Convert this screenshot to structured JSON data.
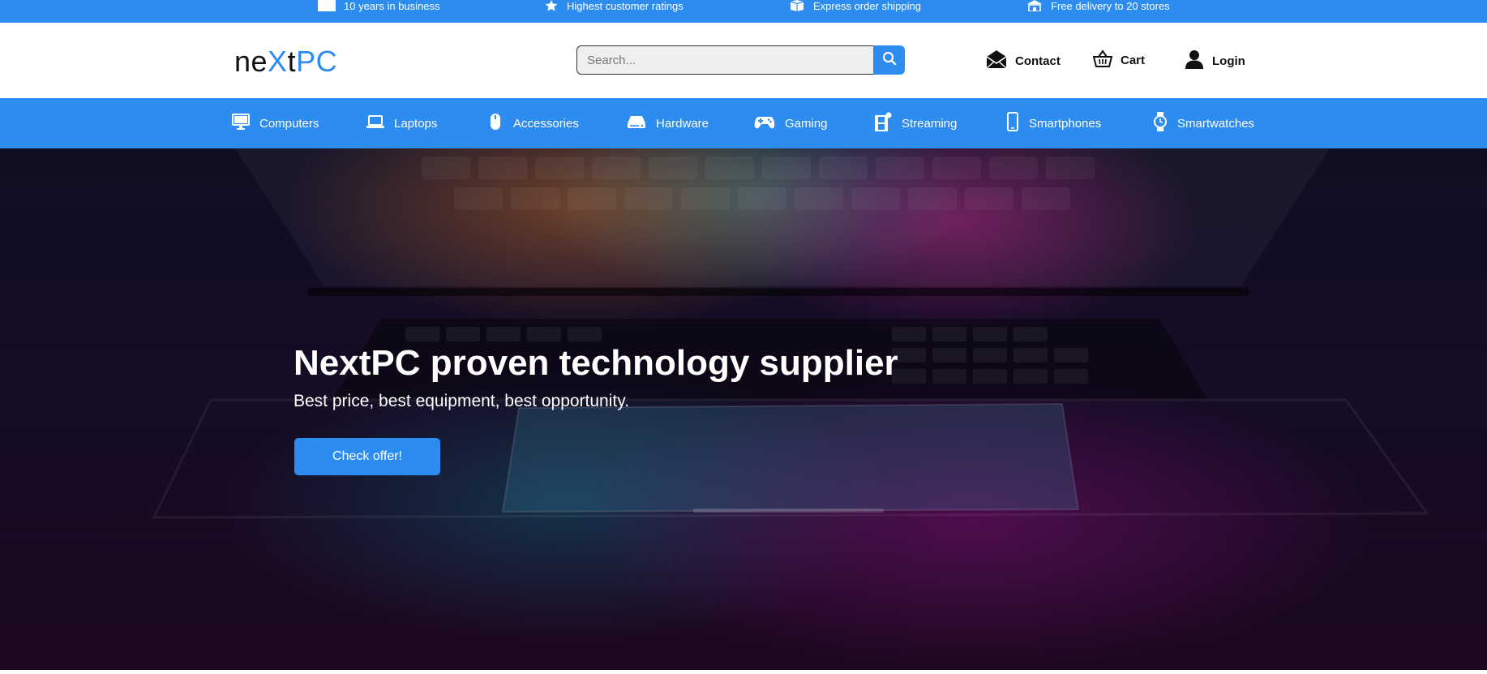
{
  "topbar": {
    "items": [
      {
        "icon": "flag-icon",
        "text": "10 years in business"
      },
      {
        "icon": "star-icon",
        "text": "Highest customer ratings"
      },
      {
        "icon": "box-icon",
        "text": "Express order shipping"
      },
      {
        "icon": "store-icon",
        "text": "Free delivery to 20 stores"
      }
    ]
  },
  "header": {
    "logo": {
      "part1": "ne",
      "part2": "X",
      "part3": "t",
      "part4": "PC"
    },
    "search": {
      "placeholder": "Search..."
    },
    "links": {
      "contact": "Contact",
      "cart": "Cart",
      "login": "Login"
    }
  },
  "nav": {
    "items": [
      {
        "label": "Computers",
        "icon": "monitor-icon"
      },
      {
        "label": "Laptops",
        "icon": "laptop-icon"
      },
      {
        "label": "Accessories",
        "icon": "mouse-icon"
      },
      {
        "label": "Hardware",
        "icon": "hard-drive-icon"
      },
      {
        "label": "Gaming",
        "icon": "gamepad-icon"
      },
      {
        "label": "Streaming",
        "icon": "film-icon"
      },
      {
        "label": "Smartphones",
        "icon": "smartphone-icon"
      },
      {
        "label": "Smartwatches",
        "icon": "watch-icon"
      }
    ]
  },
  "hero": {
    "title": "NextPC proven technology supplier",
    "subtitle": "Best price, best equipment, best opportunity.",
    "button": "Check offer!"
  },
  "colors": {
    "accent": "#2d8cf0",
    "text": "#111111"
  }
}
